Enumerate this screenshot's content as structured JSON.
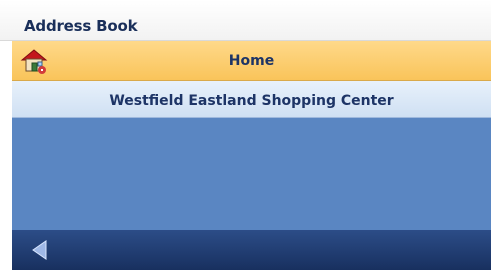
{
  "header": {
    "title": "Address Book"
  },
  "list": {
    "items": [
      {
        "label": "Home",
        "icon": "home-icon",
        "selected": true
      },
      {
        "label": "Westfield Eastland Shopping Center",
        "icon": "",
        "selected": false
      }
    ]
  },
  "footer": {
    "back_icon": "back-arrow-icon"
  },
  "colors": {
    "title_text": "#1a2f5a",
    "selected_row": "#f9c45a",
    "row_bg": "#cfe0f3",
    "list_bg": "#5a86c2",
    "bottom_bar": "#1f3b73"
  }
}
